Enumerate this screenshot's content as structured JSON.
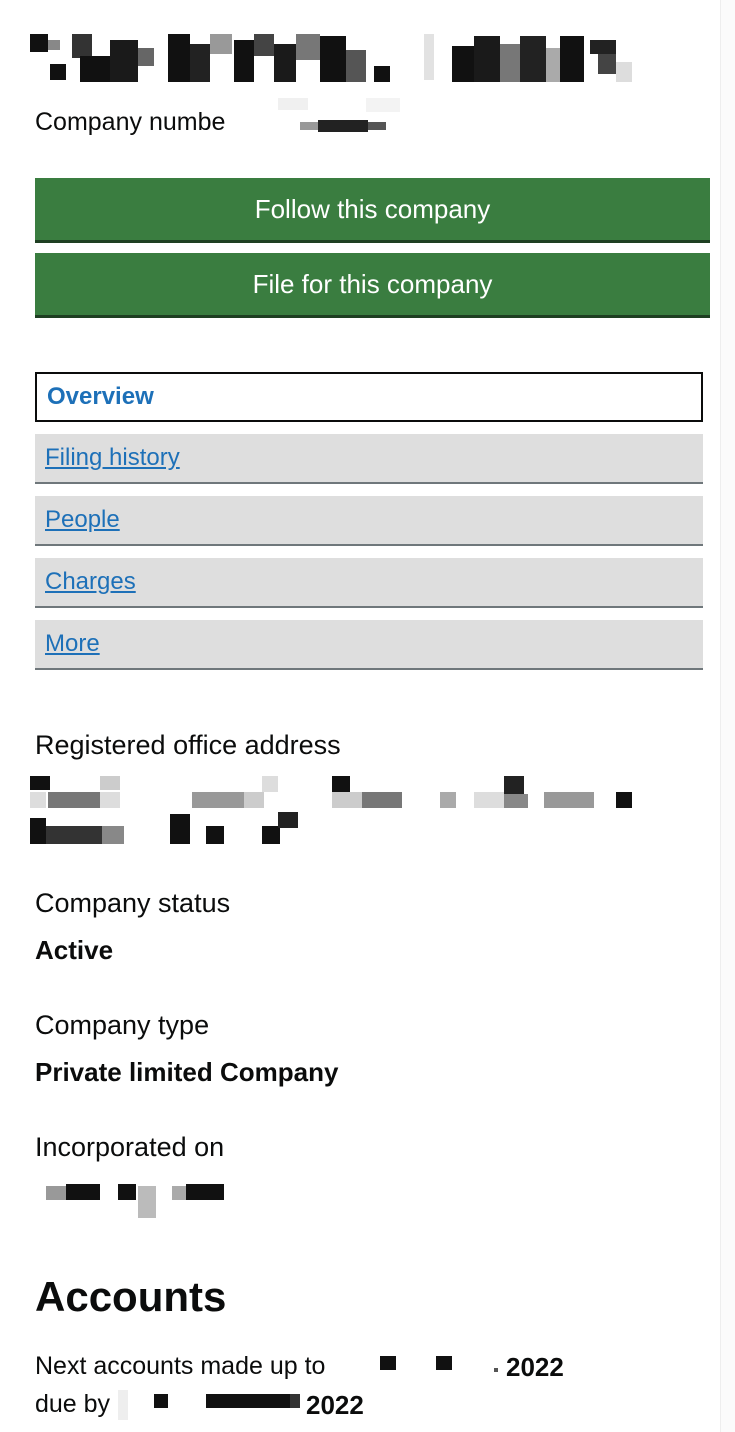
{
  "company": {
    "name_redacted": true,
    "number_label": "Company numbe"
  },
  "buttons": {
    "follow": "Follow this company",
    "file": "File for this company"
  },
  "tabs": [
    {
      "label": "Overview",
      "active": true
    },
    {
      "label": "Filing history",
      "active": false
    },
    {
      "label": "People",
      "active": false
    },
    {
      "label": "Charges",
      "active": false
    },
    {
      "label": "More",
      "active": false
    }
  ],
  "details": {
    "address_label": "Registered office address",
    "status_label": "Company status",
    "status_value": "Active",
    "type_label": "Company type",
    "type_value": "Private limited Company",
    "incorporated_label": "Incorporated on"
  },
  "accounts": {
    "heading": "Accounts",
    "next_prefix": "Next accounts made up to",
    "next_year": "2022",
    "due_prefix": "due by",
    "due_year": "2022"
  },
  "colors": {
    "button_green": "#3a7d40",
    "link_blue": "#1d70b8",
    "tab_grey": "#dedede"
  }
}
